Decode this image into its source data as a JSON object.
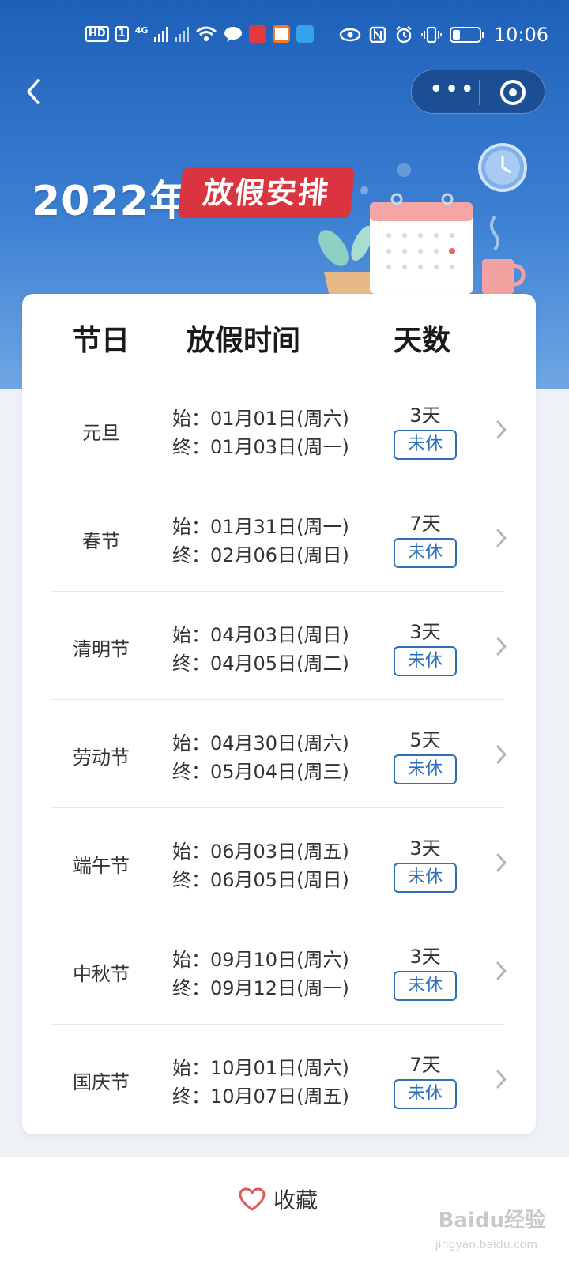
{
  "status_bar": {
    "time": "10:06",
    "hd": "HD",
    "sim": "1",
    "net": "4G"
  },
  "banner": {
    "year": "2022年",
    "tag": "放假安排"
  },
  "table": {
    "headers": [
      "节日",
      "放假时间",
      "天数"
    ],
    "rows": [
      {
        "name": "元旦",
        "start": "始：01月01日(周六)",
        "end": "终：01月03日(周一)",
        "days": "3天",
        "status": "未休"
      },
      {
        "name": "春节",
        "start": "始：01月31日(周一)",
        "end": "终：02月06日(周日)",
        "days": "7天",
        "status": "未休"
      },
      {
        "name": "清明节",
        "start": "始：04月03日(周日)",
        "end": "终：04月05日(周二)",
        "days": "3天",
        "status": "未休"
      },
      {
        "name": "劳动节",
        "start": "始：04月30日(周六)",
        "end": "终：05月04日(周三)",
        "days": "5天",
        "status": "未休"
      },
      {
        "name": "端午节",
        "start": "始：06月03日(周五)",
        "end": "终：06月05日(周日)",
        "days": "3天",
        "status": "未休"
      },
      {
        "name": "中秋节",
        "start": "始：09月10日(周六)",
        "end": "终：09月12日(周一)",
        "days": "3天",
        "status": "未休"
      },
      {
        "name": "国庆节",
        "start": "始：10月01日(周六)",
        "end": "终：10月07日(周五)",
        "days": "7天",
        "status": "未休"
      }
    ]
  },
  "bottom": {
    "favorite_label": "收藏",
    "watermark": "Baidu经验",
    "watermark_sub": "jingyan.baidu.com"
  },
  "colors": {
    "header_blue": "#1e60b8",
    "tag_red": "#d9343f",
    "status_blue": "#2e6fb8",
    "heart": "#e0575b"
  },
  "icons": [
    "back-icon",
    "more-icon",
    "target-icon",
    "chevron-right-icon",
    "heart-icon"
  ]
}
